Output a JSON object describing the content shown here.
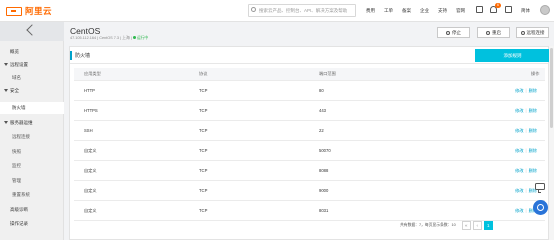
{
  "topbar": {
    "logo_text": "阿里云",
    "search_placeholder": "搜索云产品、控制台、API、解决方案及帮助",
    "nav": [
      "费用",
      "工单",
      "备案",
      "企业",
      "支持",
      "官网"
    ],
    "notification_count": "6",
    "user_label": "简体"
  },
  "sidebar": {
    "items": [
      {
        "label": "概览",
        "level": 0
      },
      {
        "label": "远程设置",
        "level": 1,
        "expanded": true
      },
      {
        "label": "域名",
        "level": 2
      },
      {
        "label": "安全",
        "level": 1,
        "expanded": true
      },
      {
        "label": "防火墙",
        "level": 2,
        "active": true
      },
      {
        "label": "服务器运维",
        "level": 1,
        "expanded": true
      },
      {
        "label": "远程连接",
        "level": 2
      },
      {
        "label": "快照",
        "level": 2
      },
      {
        "label": "监控",
        "level": 2
      },
      {
        "label": "管理",
        "level": 2
      },
      {
        "label": "重置系统",
        "level": 2
      },
      {
        "label": "高级诊断",
        "level": 0
      },
      {
        "label": "操作记录",
        "level": 0
      }
    ]
  },
  "header": {
    "title": "CentOS",
    "subtitle": "47.105.112.164 | CentOS 7.3 | 上海 | ",
    "status": "运行中",
    "buttons": [
      "停止",
      "重启",
      "远程连接"
    ]
  },
  "panel": {
    "title": "防火墙",
    "add_button": "添加规则"
  },
  "table": {
    "columns": [
      "应用类型",
      "协议",
      "端口范围",
      "操作"
    ],
    "edit_label": "修改",
    "delete_label": "删除",
    "rows": [
      {
        "app": "HTTP",
        "protocol": "TCP",
        "port": "80"
      },
      {
        "app": "HTTPS",
        "protocol": "TCP",
        "port": "443"
      },
      {
        "app": "SSH",
        "protocol": "TCP",
        "port": "22"
      },
      {
        "app": "自定义",
        "protocol": "TCP",
        "port": "50070"
      },
      {
        "app": "自定义",
        "protocol": "TCP",
        "port": "8088"
      },
      {
        "app": "自定义",
        "protocol": "TCP",
        "port": "9000"
      },
      {
        "app": "自定义",
        "protocol": "TCP",
        "port": "8031"
      }
    ]
  },
  "pager": {
    "info": "共有数据：7，每页显示条数：10",
    "prev": "«",
    "prev2": "‹",
    "current": "1"
  },
  "colors": {
    "brand": "#ff6a00",
    "accent": "#00c1de",
    "link": "#00a2ca",
    "status_running": "#2db84d"
  }
}
